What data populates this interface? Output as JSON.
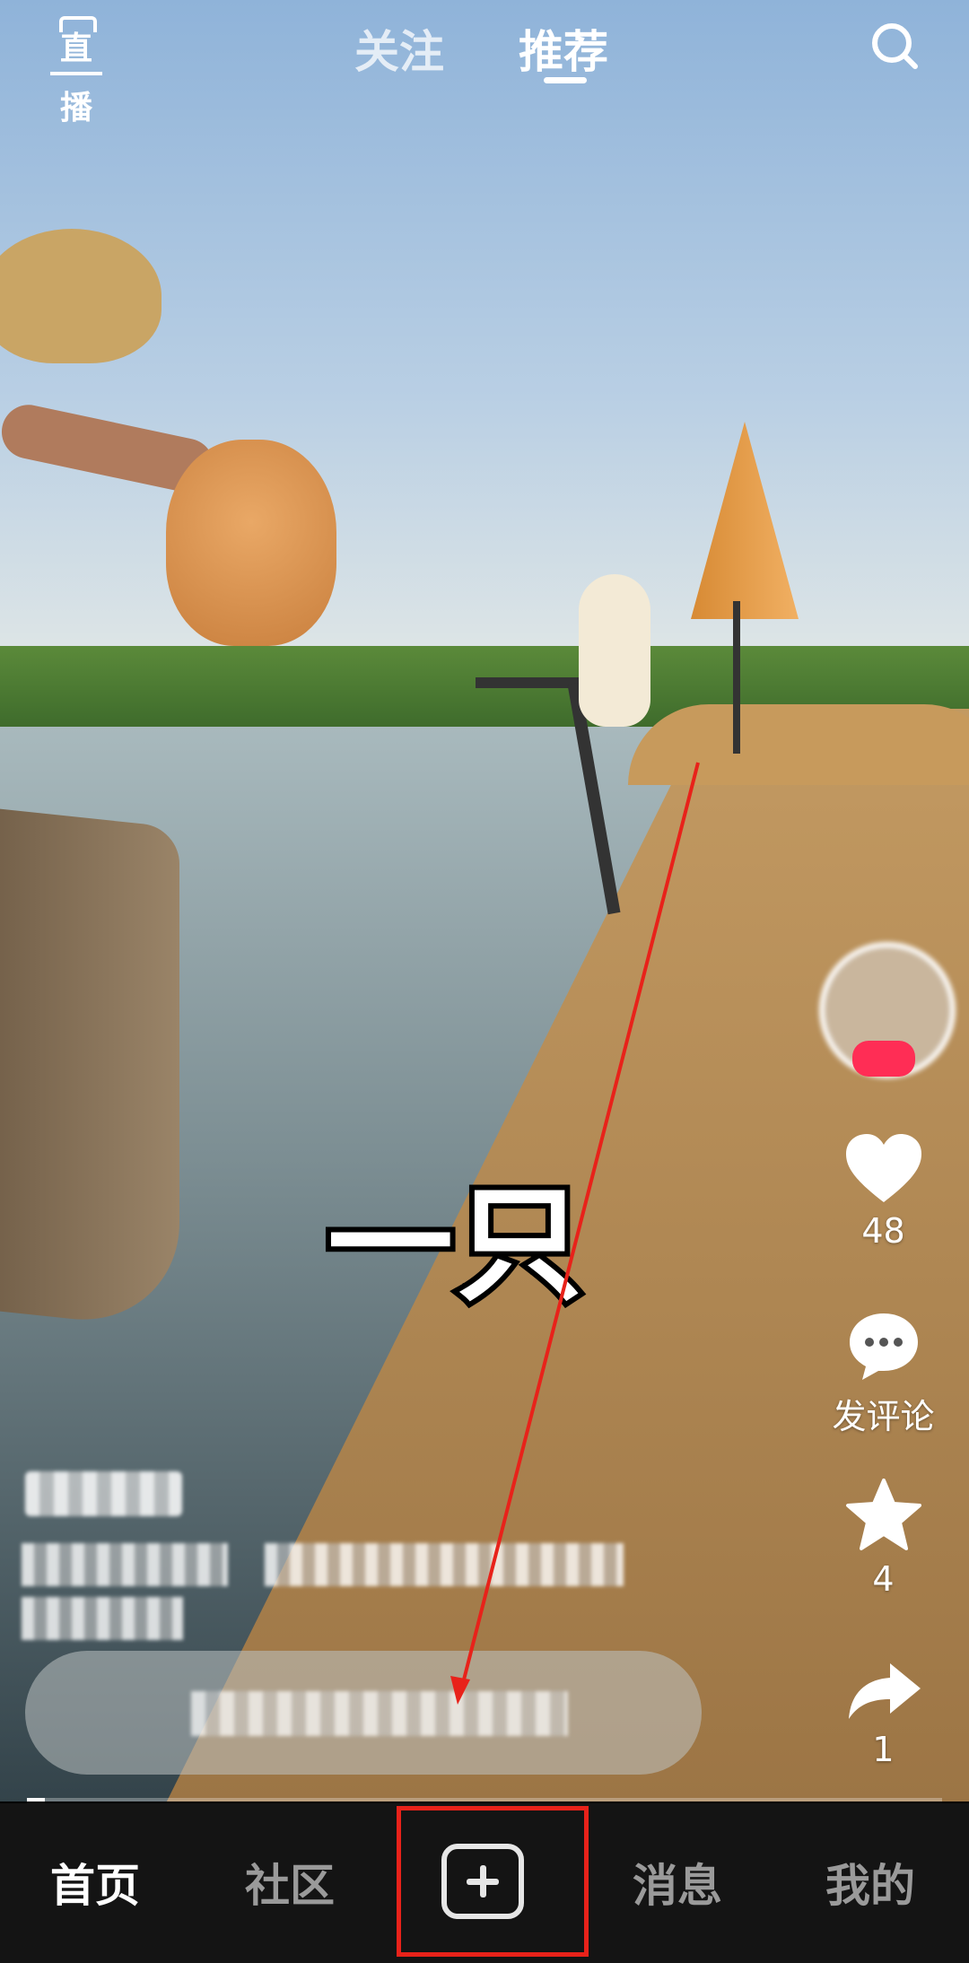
{
  "topbar": {
    "live_label": "直播",
    "tabs": [
      {
        "label": "关注",
        "active": false
      },
      {
        "label": "推荐",
        "active": true
      }
    ]
  },
  "video": {
    "caption": "一只",
    "progress_fraction": 0.02
  },
  "actions": {
    "likes": "48",
    "comment_label": "发评论",
    "favorites": "4",
    "shares": "1"
  },
  "bottom_nav": {
    "items": [
      {
        "label": "首页",
        "active": true
      },
      {
        "label": "社区",
        "active": false
      },
      {
        "label": "",
        "icon": "add-icon"
      },
      {
        "label": "消息",
        "active": false
      },
      {
        "label": "我的",
        "active": false
      }
    ]
  },
  "colors": {
    "nav_background": "#141414",
    "annotation_red": "#e8221a",
    "follow_badge": "#ff2d55"
  }
}
